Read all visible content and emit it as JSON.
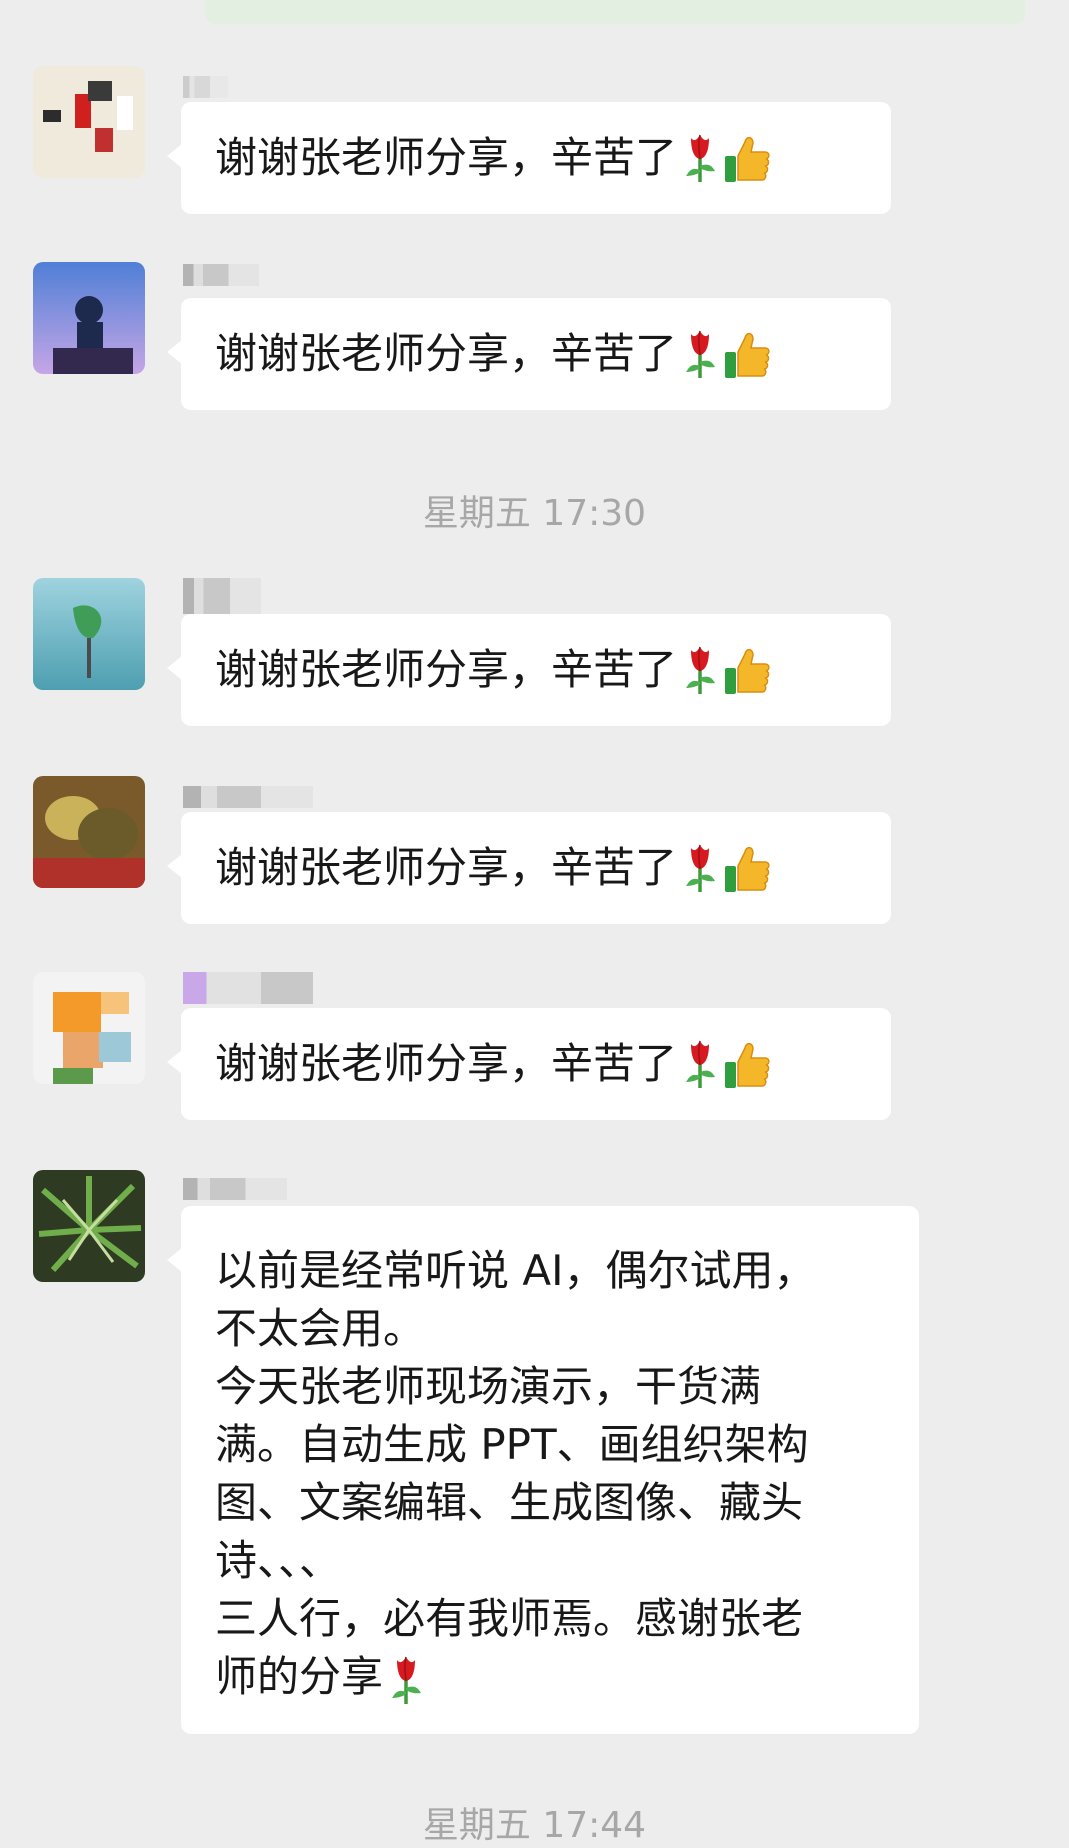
{
  "messages": [
    {
      "text": "谢谢张老师分享，辛苦了",
      "emojis": [
        "rose",
        "thumbs-up"
      ]
    },
    {
      "text": "谢谢张老师分享，辛苦了",
      "emojis": [
        "rose",
        "thumbs-up"
      ]
    },
    {
      "text": "谢谢张老师分享，辛苦了",
      "emojis": [
        "rose",
        "thumbs-up"
      ]
    },
    {
      "text": "谢谢张老师分享，辛苦了",
      "emojis": [
        "rose",
        "thumbs-up"
      ]
    },
    {
      "text": "谢谢张老师分享，辛苦了",
      "emojis": [
        "rose",
        "thumbs-up"
      ]
    },
    {
      "lines": [
        "以前是经常听说 AI，偶尔试用，",
        "不太会用。",
        "今天张老师现场演示，干货满",
        "满。自动生成 PPT、画组织架构",
        "图、文案编辑、生成图像、藏头",
        "诗、、、",
        "三人行，必有我师焉。感谢张老",
        "师的分享"
      ],
      "emojis": [
        "rose"
      ]
    }
  ],
  "timestamps": [
    "星期五 17:30",
    "星期五 17:44"
  ],
  "icons": [
    "rose-emoji",
    "thumbs-up-emoji"
  ],
  "colors": {
    "background": "#ededed",
    "bubble": "#ffffff",
    "timestamp": "#a7a7a7"
  }
}
